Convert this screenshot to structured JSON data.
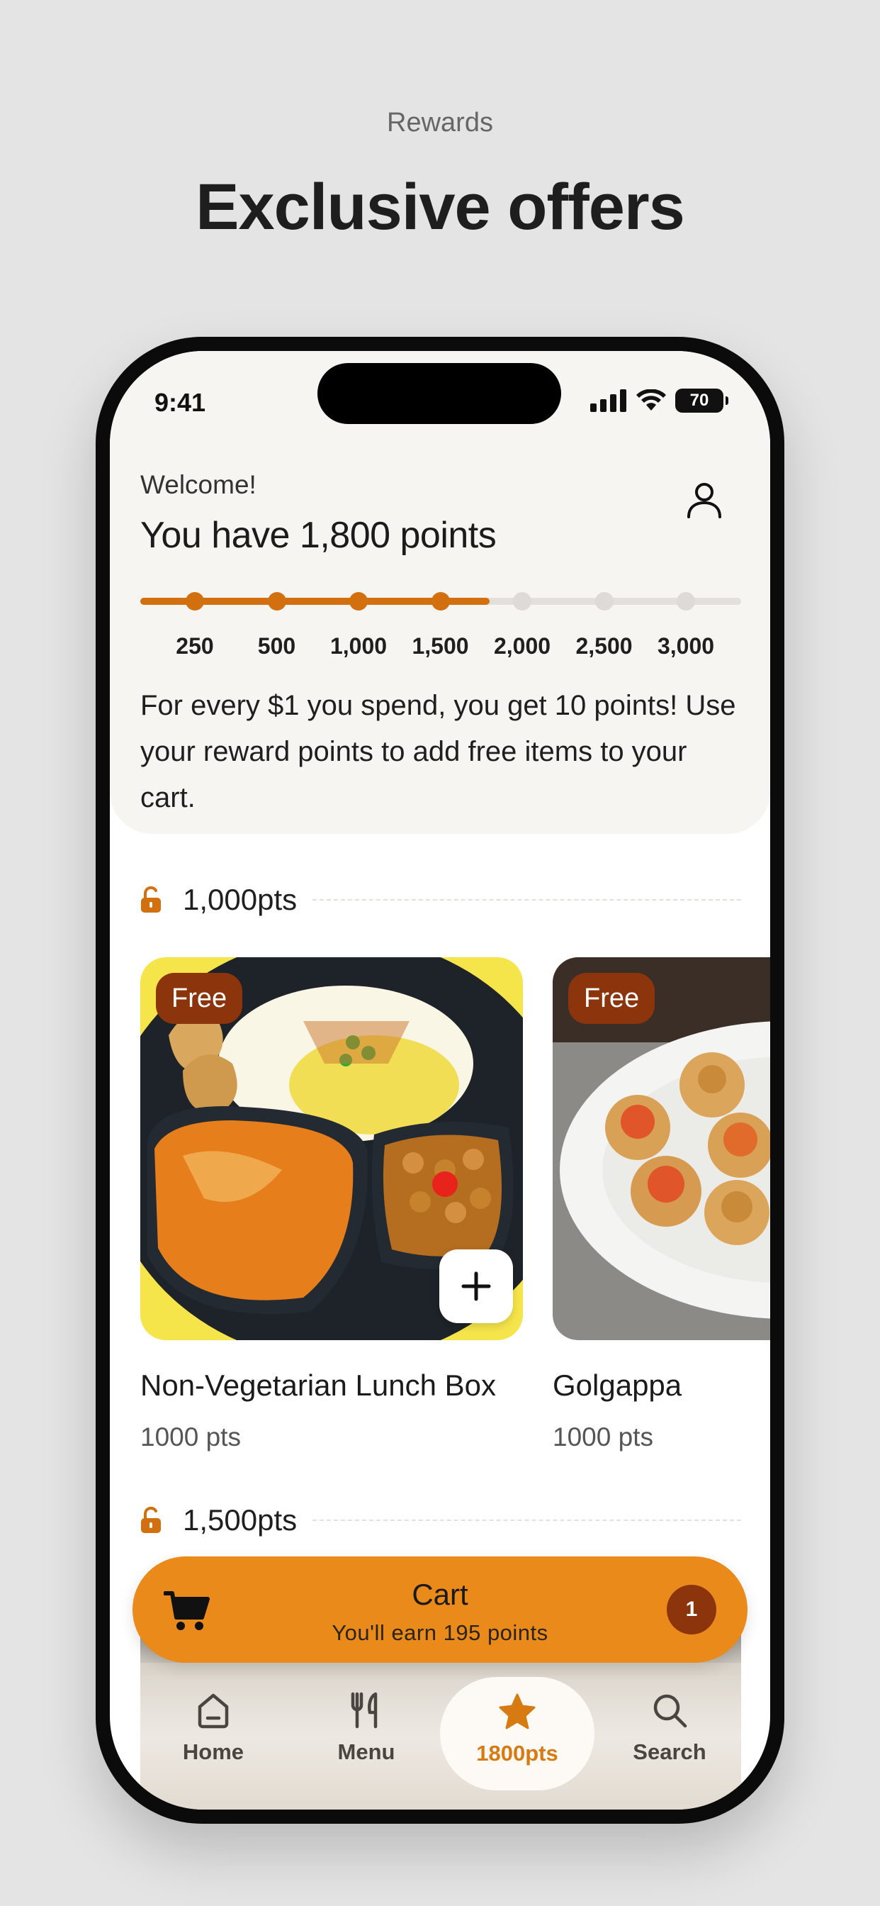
{
  "page": {
    "eyebrow": "Rewards",
    "headline": "Exclusive offers"
  },
  "status_bar": {
    "time": "9:41",
    "battery": "70"
  },
  "header": {
    "welcome": "Welcome!",
    "points_title": "You have 1,800 points",
    "info": "For every $1 you spend, you get 10 points! Use your reward points to add free items to your cart.",
    "progress": {
      "current_points": 1800,
      "max_points": 3000,
      "milestones": [
        "250",
        "500",
        "1,000",
        "1,500",
        "2,000",
        "2,500",
        "3,000"
      ],
      "reached_count": 4
    }
  },
  "sections": [
    {
      "label": "1,000pts",
      "items": [
        {
          "badge": "Free",
          "name": "Non-Vegetarian Lunch Box",
          "pts": "1000 pts"
        },
        {
          "badge": "Free",
          "name": "Golgappa",
          "pts": "1000 pts"
        }
      ]
    },
    {
      "label": "1,500pts",
      "items": []
    }
  ],
  "cart": {
    "title": "Cart",
    "subtitle": "You'll earn 195 points",
    "count": "1"
  },
  "tabs": [
    {
      "label": "Home",
      "icon": "home-icon"
    },
    {
      "label": "Menu",
      "icon": "utensils-icon"
    },
    {
      "label": "1800pts",
      "icon": "star-icon"
    },
    {
      "label": "Search",
      "icon": "search-icon"
    }
  ],
  "colors": {
    "accent": "#d2700f",
    "cart_bg": "#e98a1a",
    "badge": "#8c350d"
  }
}
